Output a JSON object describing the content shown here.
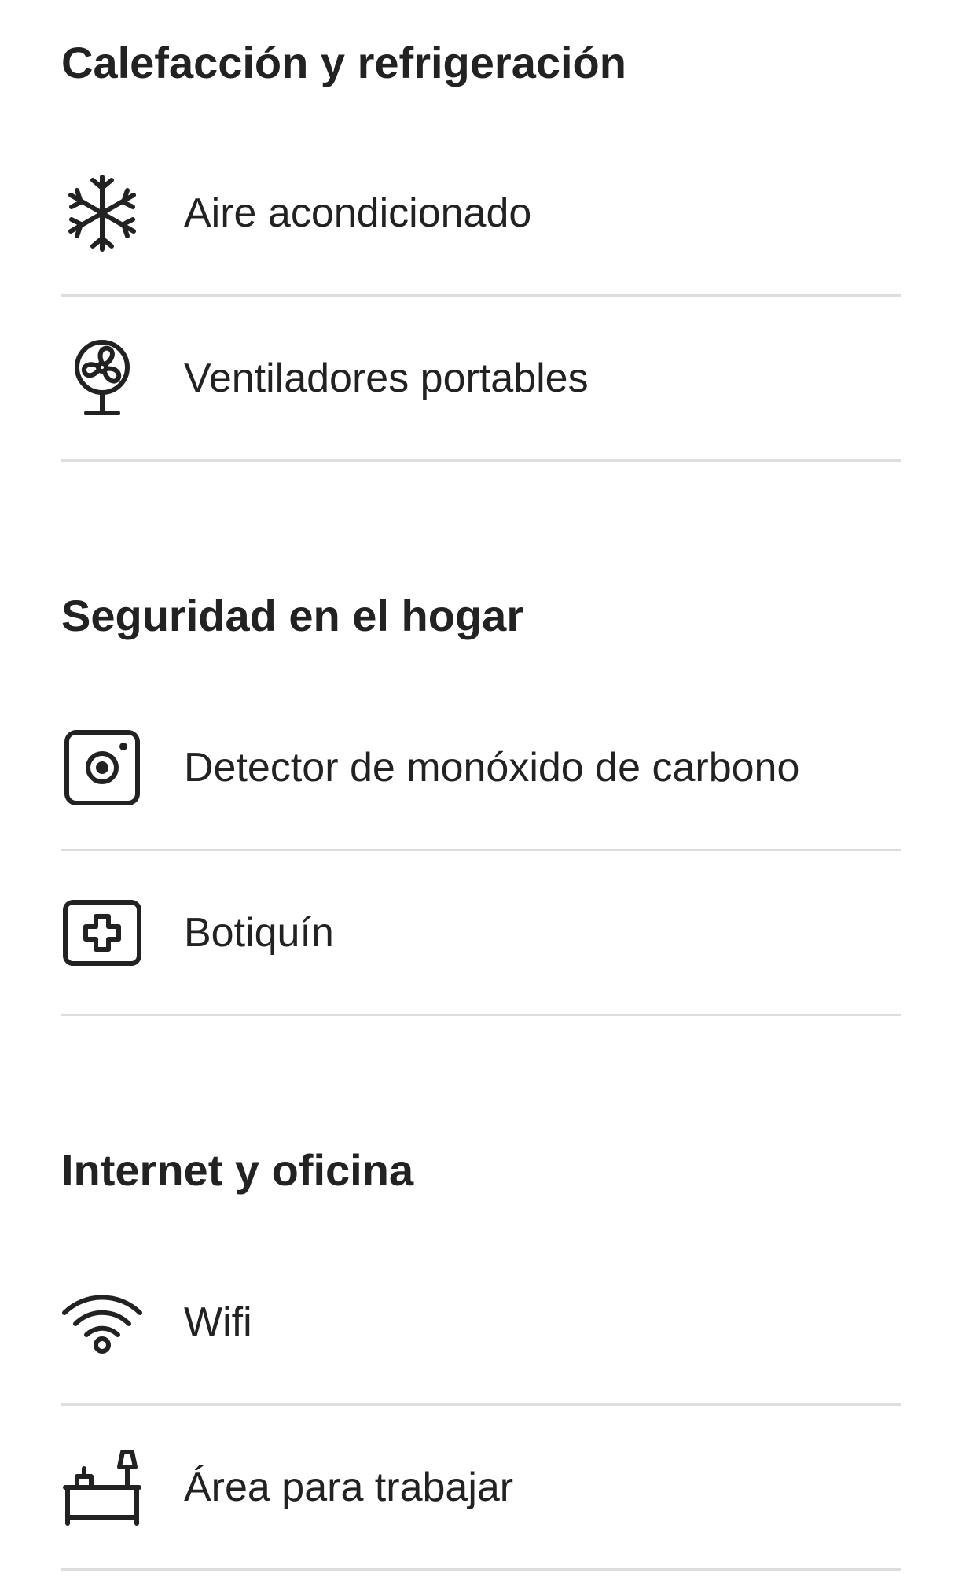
{
  "sections": [
    {
      "title": "Calefacción y refrigeración",
      "items": [
        {
          "label": "Aire acondicionado",
          "icon": "snowflake-icon"
        },
        {
          "label": "Ventiladores portables",
          "icon": "fan-icon"
        }
      ]
    },
    {
      "title": "Seguridad en el hogar",
      "items": [
        {
          "label": "Detector de monóxido de carbono",
          "icon": "carbon-monoxide-detector-icon"
        },
        {
          "label": "Botiquín",
          "icon": "first-aid-kit-icon"
        }
      ]
    },
    {
      "title": "Internet y oficina",
      "items": [
        {
          "label": "Wifi",
          "icon": "wifi-icon"
        },
        {
          "label": "Área para trabajar",
          "icon": "workspace-desk-icon"
        }
      ]
    }
  ],
  "colors": {
    "text": "#222222",
    "divider": "#dddddd",
    "background": "#ffffff"
  }
}
